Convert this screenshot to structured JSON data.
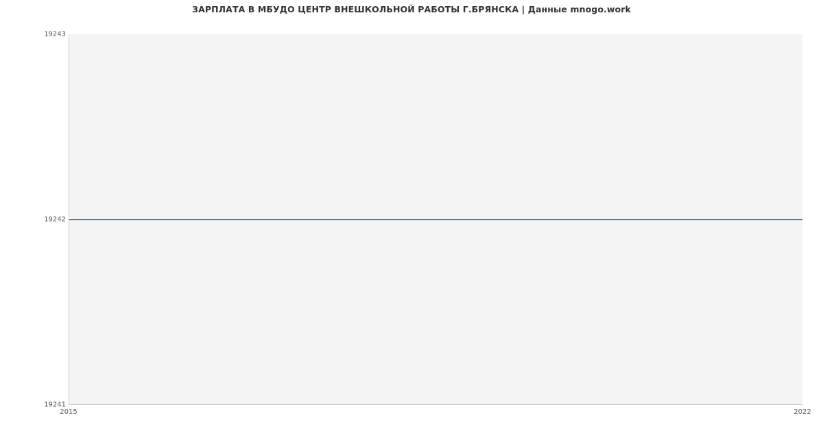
{
  "chart_data": {
    "type": "line",
    "title": "ЗАРПЛАТА В МБУДО ЦЕНТР ВНЕШКОЛЬНОЙ РАБОТЫ Г.БРЯНСКА | Данные mnogo.work",
    "xlabel": "",
    "ylabel": "",
    "x": [
      2015,
      2022
    ],
    "values": [
      19242,
      19242
    ],
    "xlim": [
      2015,
      2022
    ],
    "ylim": [
      19241,
      19243
    ],
    "yticks": [
      19241,
      19242,
      19243
    ],
    "xticks": [
      2015,
      2022
    ],
    "series_color": "#3b7fc4",
    "plot_bg": "#f4f4f4"
  },
  "ylabels": {
    "t0": "19241",
    "t1": "19242",
    "t2": "19243"
  },
  "xlabels": {
    "x0": "2015",
    "x1": "2022"
  }
}
